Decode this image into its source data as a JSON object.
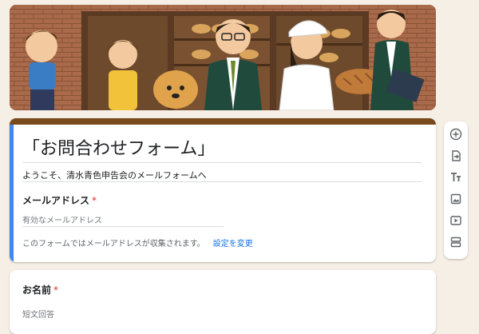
{
  "form": {
    "title": "「お問合わせフォーム」",
    "description": "ようこそ、清水青色申告会のメールフォームへ",
    "email_question": {
      "label": "メールアドレス",
      "required_mark": "*",
      "placeholder": "有効なメールアドレス",
      "note": "このフォームではメールアドレスが収集されます。",
      "change_link": "設定を変更"
    },
    "name_question": {
      "label": "お名前",
      "required_mark": "*",
      "placeholder": "短文回答"
    }
  },
  "toolbar": {
    "icons": [
      "add-question-icon",
      "import-questions-icon",
      "add-title-icon",
      "add-image-icon",
      "add-video-icon",
      "add-section-icon"
    ]
  },
  "colors": {
    "accent": "#4285f4",
    "header_bar": "#7a4a1f",
    "link": "#1a73e8",
    "required": "#d93025",
    "page_bg": "#f6efe6"
  }
}
